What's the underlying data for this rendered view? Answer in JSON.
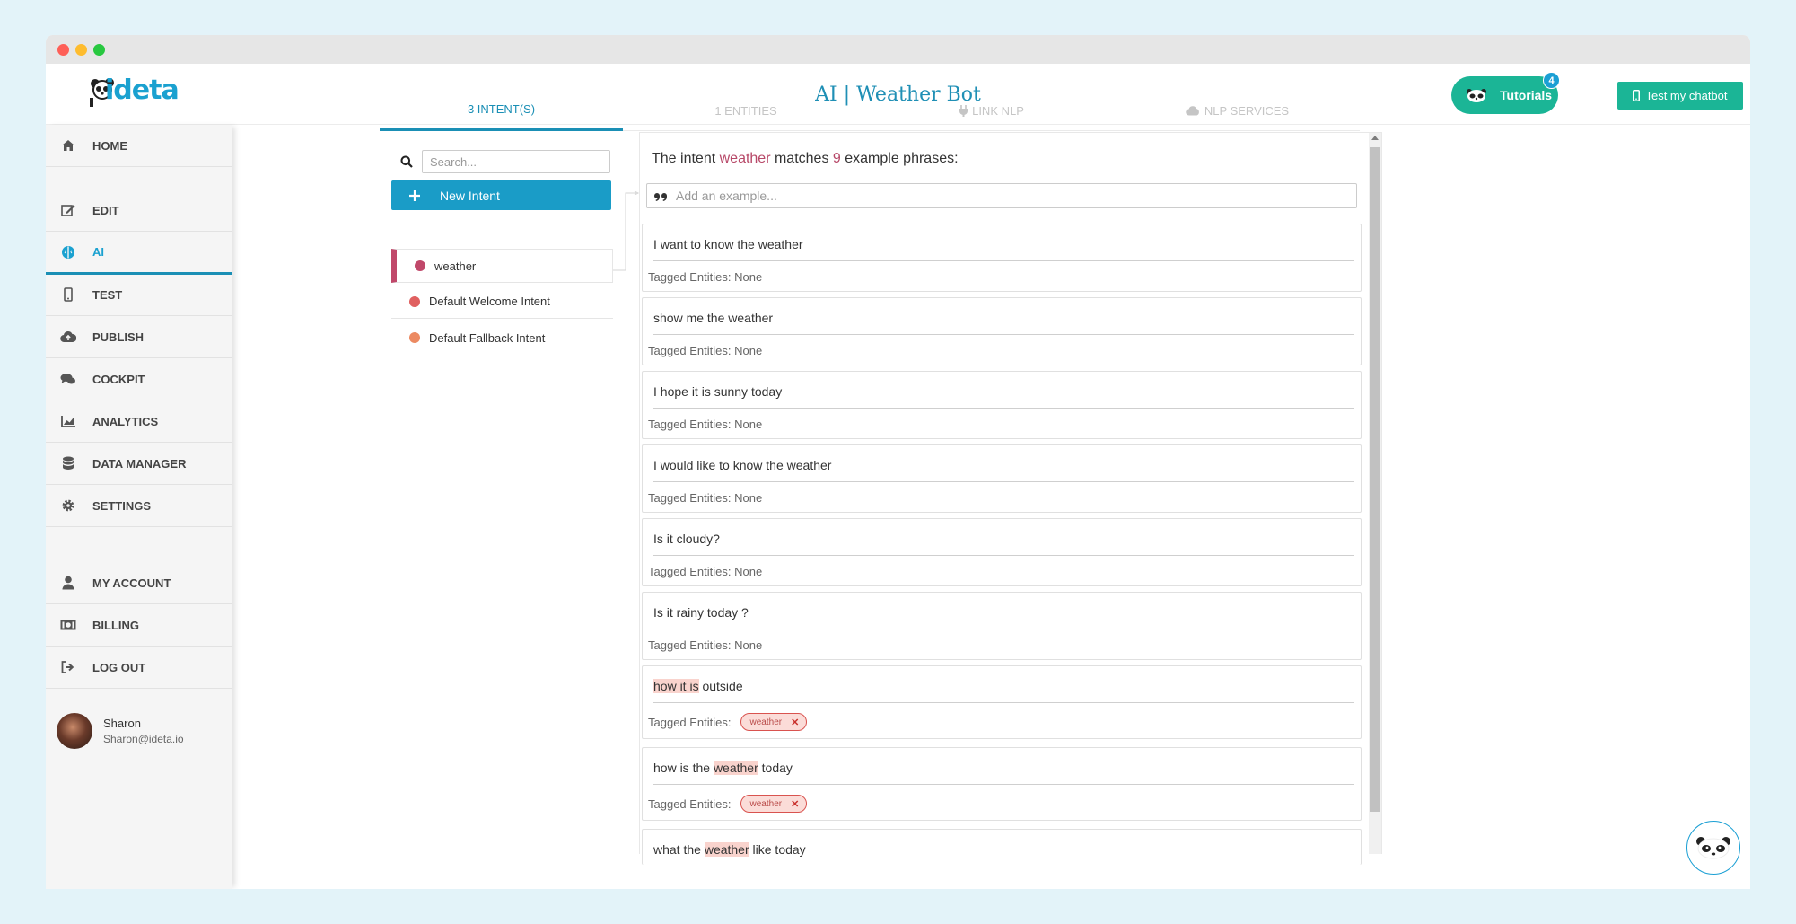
{
  "app": {
    "logo_text": "ideta",
    "title": "AI | Weather Bot"
  },
  "header": {
    "tutorials_label": "Tutorials",
    "tutorials_badge": "4",
    "test_label": "Test my chatbot"
  },
  "sidebar": {
    "items": [
      {
        "label": "HOME",
        "icon": "home-icon"
      },
      {
        "label": "EDIT",
        "icon": "edit-icon"
      },
      {
        "label": "AI",
        "icon": "brain-icon",
        "active": true
      },
      {
        "label": "TEST",
        "icon": "mobile-icon"
      },
      {
        "label": "PUBLISH",
        "icon": "cloud-upload-icon"
      },
      {
        "label": "COCKPIT",
        "icon": "chat-icon"
      },
      {
        "label": "ANALYTICS",
        "icon": "chart-icon"
      },
      {
        "label": "DATA MANAGER",
        "icon": "database-icon"
      },
      {
        "label": "SETTINGS",
        "icon": "gear-icon"
      },
      {
        "label": "MY ACCOUNT",
        "icon": "user-icon"
      },
      {
        "label": "BILLING",
        "icon": "money-icon"
      },
      {
        "label": "LOG OUT",
        "icon": "logout-icon"
      }
    ],
    "user": {
      "name": "Sharon",
      "email": "Sharon@ideta.io"
    }
  },
  "tabs": [
    {
      "label": "3 INTENT(S)",
      "active": true
    },
    {
      "label": "1 ENTITIES"
    },
    {
      "label": "LINK NLP"
    },
    {
      "label": "NLP SERVICES"
    }
  ],
  "intents": {
    "search_placeholder": "Search...",
    "new_intent_label": "New Intent",
    "list": [
      {
        "name": "weather",
        "color": "#c0486a",
        "active": true
      },
      {
        "name": "Default Welcome Intent",
        "color": "#e06060"
      },
      {
        "name": "Default Fallback Intent",
        "color": "#ec8a62"
      }
    ]
  },
  "detail": {
    "matches_prefix": "The intent ",
    "intent_name": "weather",
    "matches_mid": " matches ",
    "count": "9",
    "matches_suffix": " example phrases:",
    "add_placeholder": "Add an example...",
    "tagged_label": "Tagged Entities:",
    "none_text": "None",
    "phrases": [
      {
        "text": "I want to know the weather"
      },
      {
        "text": "show me the weather"
      },
      {
        "text": "I hope it is sunny today"
      },
      {
        "text": "I would like to know the weather"
      },
      {
        "text": "Is it cloudy?"
      },
      {
        "text": "Is it rainy today ?"
      },
      {
        "pre": "",
        "mark": "how it is",
        "post": " outside",
        "entity": "weather"
      },
      {
        "pre": "how is the ",
        "mark": "weather",
        "post": " today",
        "entity": "weather"
      },
      {
        "pre": "what the ",
        "mark": "weather",
        "post": " like today"
      }
    ]
  }
}
